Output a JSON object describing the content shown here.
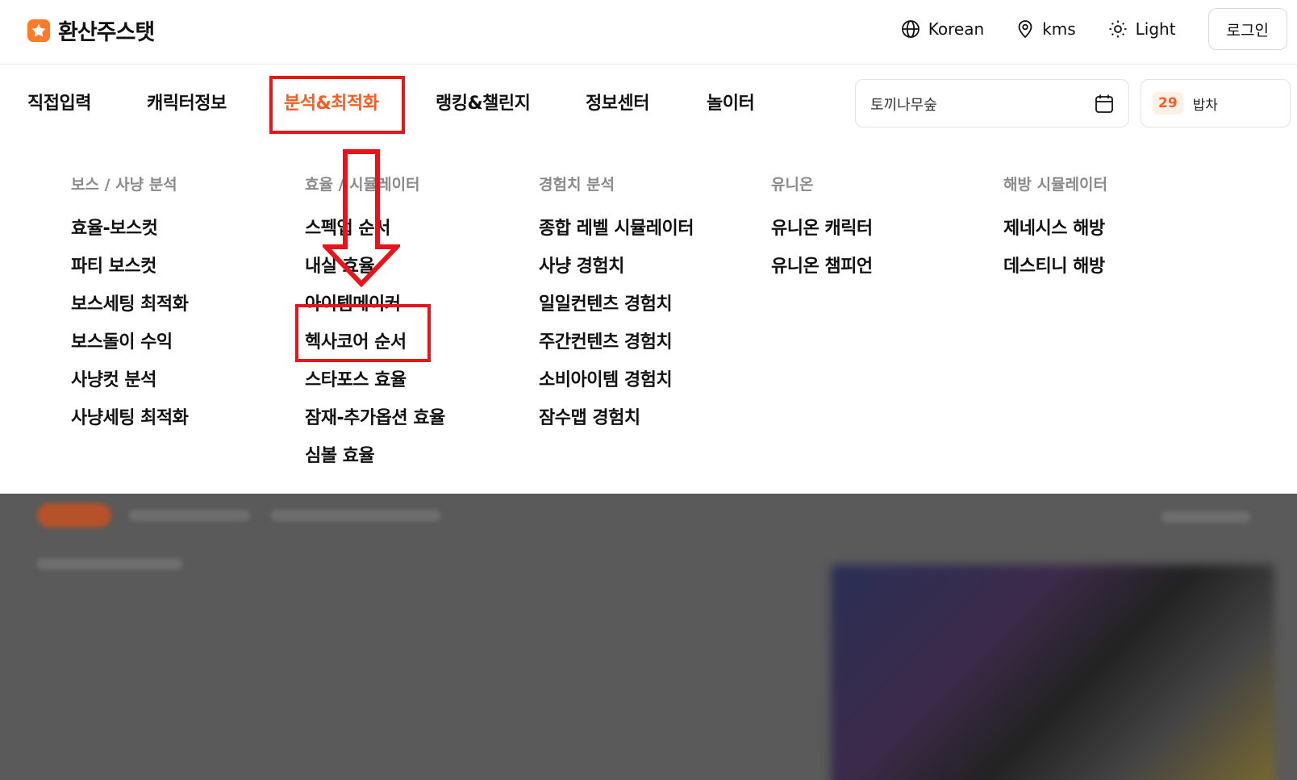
{
  "header": {
    "logo_text": "환산주스탯",
    "language_label": "Korean",
    "region_label": "kms",
    "theme_label": "Light",
    "login_label": "로그인"
  },
  "nav": {
    "items": [
      {
        "label": "직접입력"
      },
      {
        "label": "캐릭터정보"
      },
      {
        "label": "분석&최적화"
      },
      {
        "label": "랭킹&챌린지"
      },
      {
        "label": "정보센터"
      },
      {
        "label": "놀이터"
      }
    ],
    "active_index": 2,
    "search_value": "토끼나무숲",
    "count_value": "29",
    "count_label": "밥차"
  },
  "menu": {
    "columns": [
      {
        "heading": "보스 / 사냥 분석",
        "items": [
          "효율-보스컷",
          "파티 보스컷",
          "보스세팅 최적화",
          "보스돌이 수익",
          "사냥컷 분석",
          "사냥세팅 최적화"
        ]
      },
      {
        "heading": "효율 / 시뮬레이터",
        "items": [
          "스펙업 순서",
          "내실 효율",
          "아이템메이커",
          "헥사코어 순서",
          "스타포스 효율",
          "잠재-추가옵션 효율",
          "심볼 효율"
        ]
      },
      {
        "heading": "경험치 분석",
        "items": [
          "종합 레벨 시뮬레이터",
          "사냥 경험치",
          "일일컨텐츠 경험치",
          "주간컨텐츠 경험치",
          "소비아이템 경험치",
          "잠수맵 경험치"
        ]
      },
      {
        "heading": "유니온",
        "items": [
          "유니온 캐릭터",
          "유니온 챔피언"
        ]
      },
      {
        "heading": "해방 시뮬레이터",
        "items": [
          "제네시스 해방",
          "데스티니 해방"
        ]
      }
    ]
  },
  "colors": {
    "accent": "#ff5a1f",
    "annotation_red": "#e8141b",
    "logo_orange": "#ff7a29"
  },
  "icons": {
    "language": "globe-icon",
    "region": "location-pin-icon",
    "theme": "sun-icon",
    "date": "calendar-icon",
    "annotation": "down-arrow-icon"
  }
}
